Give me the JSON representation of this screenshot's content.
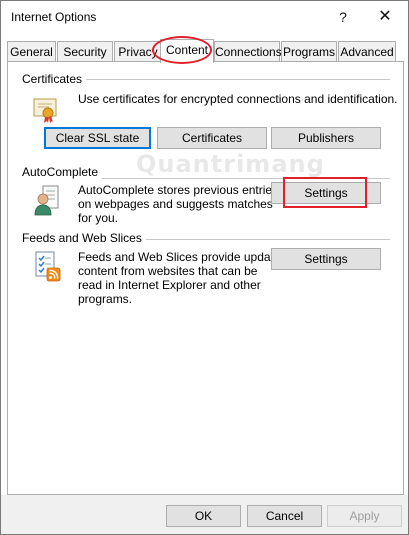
{
  "window": {
    "title": "Internet Options",
    "help_glyph": "?",
    "close_glyph": "✕"
  },
  "tabs": [
    {
      "label": "General"
    },
    {
      "label": "Security"
    },
    {
      "label": "Privacy"
    },
    {
      "label": "Content",
      "active": true
    },
    {
      "label": "Connections"
    },
    {
      "label": "Programs"
    },
    {
      "label": "Advanced"
    }
  ],
  "certificates": {
    "heading": "Certificates",
    "description": "Use certificates for encrypted connections and identification.",
    "icon": "certificate-icon",
    "clear_ssl_label": "Clear SSL state",
    "certificates_label": "Certificates",
    "publishers_label": "Publishers"
  },
  "autocomplete": {
    "heading": "AutoComplete",
    "description_line1": "AutoComplete stores previous entries",
    "description_line2": "on webpages and suggests matches",
    "description_line3": "for you.",
    "icon": "user-form-icon",
    "settings_label": "Settings"
  },
  "feeds": {
    "heading": "Feeds and Web Slices",
    "description_line1": "Feeds and Web Slices provide updated",
    "description_line2": "content from websites that can be",
    "description_line3": "read in Internet Explorer and other",
    "description_line4": "programs.",
    "icon": "rss-feed-icon",
    "settings_label": "Settings"
  },
  "footer": {
    "ok_label": "OK",
    "cancel_label": "Cancel",
    "apply_label": "Apply"
  },
  "watermark": "Quantrimang",
  "colors": {
    "focus_border": "#0078d7",
    "annotation_red": "#e0202a",
    "button_bg": "#e1e1e1"
  }
}
